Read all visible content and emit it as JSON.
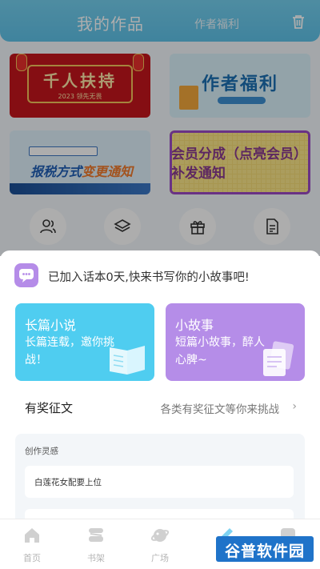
{
  "header": {
    "title": "我的作品",
    "tab": "作者福利",
    "trash_icon": "trash-icon"
  },
  "banners": [
    {
      "title": "千人扶持",
      "subtitle": "2023 领先无畏"
    },
    {
      "title": "作者福利"
    },
    {
      "title_plain": "报税方式",
      "title_highlight": "变更通知"
    },
    {
      "title": "会员分成（点亮会员）补发通知"
    }
  ],
  "quick_actions": [
    "user-group-icon",
    "layers-icon",
    "gift-icon",
    "document-icon"
  ],
  "sheet": {
    "tip": "已加入话本0天,快来书写你的小故事吧!",
    "cards": [
      {
        "title": "长篇小说",
        "desc": "长篇连载，邀你挑战！",
        "color": "#4fcdf0"
      },
      {
        "title": "小故事",
        "desc": "短篇小故事，醉人心脾~",
        "color": "#b58de8"
      }
    ],
    "contest": {
      "label": "有奖征文",
      "hint": "各类有奖征文等你来挑战",
      "chevron": "›"
    },
    "inspiration": {
      "title": "创作灵感",
      "items": [
        "白莲花女配要上位",
        ""
      ]
    }
  },
  "tabbar": {
    "tabs": [
      {
        "label": "首页",
        "icon": "home-icon"
      },
      {
        "label": "书架",
        "icon": "bookshelf-icon"
      },
      {
        "label": "广场",
        "icon": "planet-icon"
      },
      {
        "label": "",
        "icon": "write-icon"
      },
      {
        "label": "",
        "icon": "profile-icon"
      }
    ]
  },
  "watermark": "谷普软件园",
  "colors": {
    "header": "#5ec2e8",
    "long_card": "#4fcdf0",
    "short_card": "#b58de8",
    "tip_icon": "#b58ce8"
  }
}
